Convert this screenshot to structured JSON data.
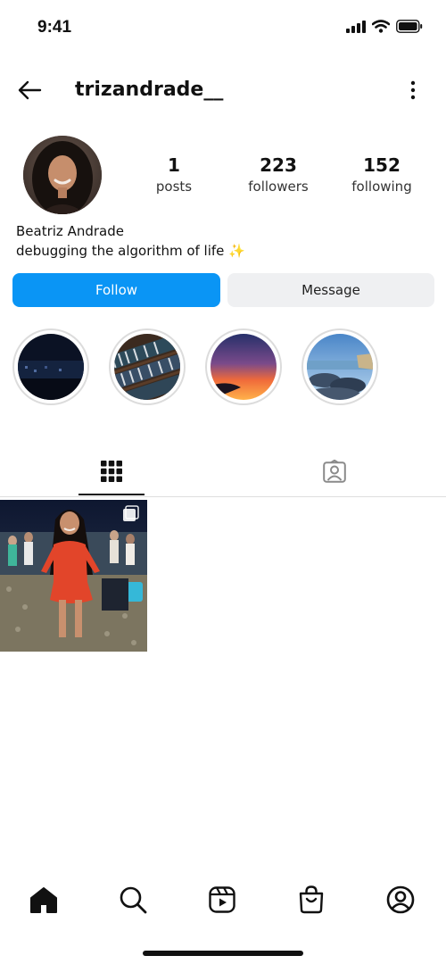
{
  "status_bar": {
    "time": "9:41",
    "icons": [
      "signal-icon",
      "wifi-icon",
      "battery-icon"
    ]
  },
  "header": {
    "username": "trizandrade__",
    "back_icon": "back-arrow-icon",
    "more_icon": "more-vertical-icon"
  },
  "profile": {
    "stats": {
      "posts": {
        "count": "1",
        "label": "posts"
      },
      "followers": {
        "count": "223",
        "label": "followers"
      },
      "following": {
        "count": "152",
        "label": "following"
      }
    },
    "full_name": "Beatriz Andrade",
    "bio": "debugging the algorithm of life ✨"
  },
  "actions": {
    "follow_label": "Follow",
    "message_label": "Message"
  },
  "highlights": [
    "night-city",
    "bookshelf",
    "sunset",
    "coast"
  ],
  "tabs": {
    "grid_icon": "grid-icon",
    "tagged_icon": "tagged-icon",
    "active": "grid"
  },
  "bottom_nav": [
    "home-icon",
    "search-icon",
    "reels-icon",
    "shop-icon",
    "profile-icon"
  ],
  "colors": {
    "accent": "#0a95f5",
    "secondary_button": "#eff0f2",
    "text": "#111111"
  }
}
